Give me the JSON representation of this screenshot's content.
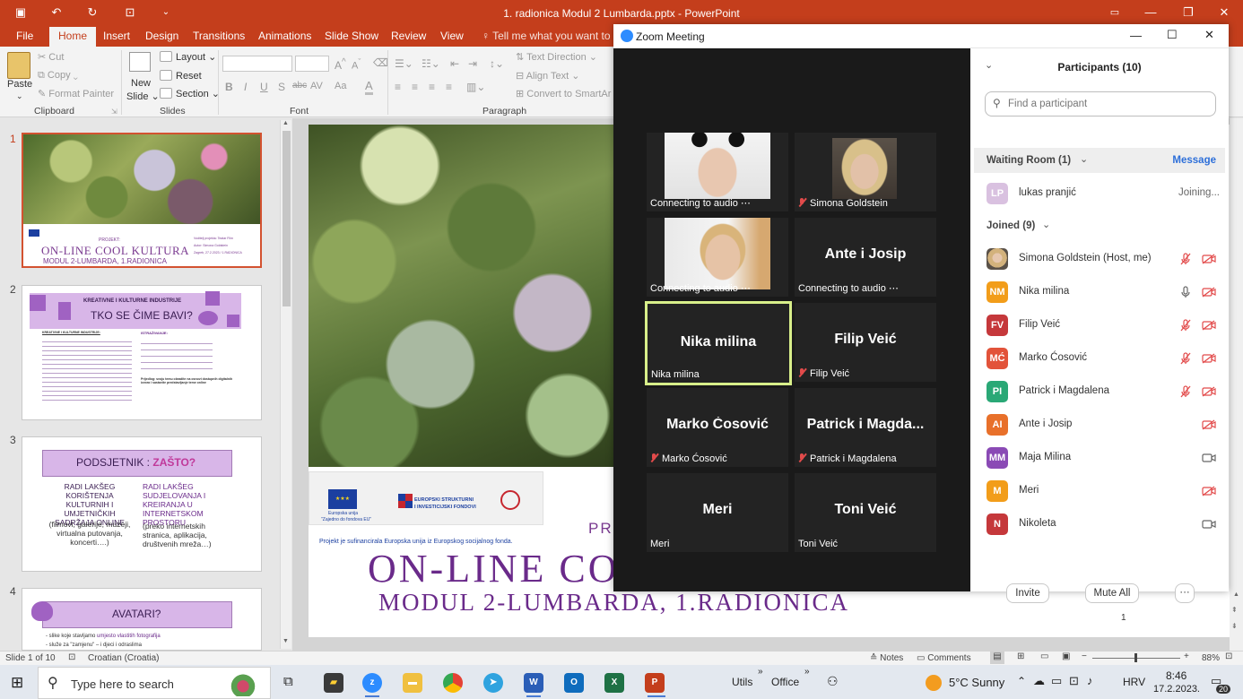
{
  "ppt": {
    "window_title": "1. radionica Modul 2 Lumbarda.pptx - PowerPoint",
    "tabs": [
      "File",
      "Home",
      "Insert",
      "Design",
      "Transitions",
      "Animations",
      "Slide Show",
      "Review",
      "View"
    ],
    "tell_me": "Tell me what you want to d",
    "clipboard": {
      "paste": "Paste",
      "cut": "Cut",
      "copy": "Copy",
      "format_painter": "Format Painter",
      "label": "Clipboard"
    },
    "slides_group": {
      "new_slide": "New",
      "new_slide2": "Slide",
      "layout": "Layout",
      "reset": "Reset",
      "section": "Section",
      "label": "Slides"
    },
    "font_group": {
      "label": "Font",
      "bold": "B",
      "italic": "I",
      "underline": "U",
      "shadow": "S",
      "strike": "abc",
      "spacing": "AV",
      "case": "Aa",
      "color": "A"
    },
    "paragraph_group": {
      "label": "Paragraph",
      "text_direction": "Text Direction",
      "align_text": "Align Text",
      "smartart": "Convert to SmartAr"
    },
    "slide_numbers": [
      "1",
      "2",
      "3",
      "4"
    ],
    "thumb1": {
      "projekt": "PROJEKT:",
      "title": "ON-LINE COOL KULTURA",
      "subtitle": "MODUL 2-LUMBARDA, 1.RADIONICA",
      "info1": "Voditelj projekta: Teatar Film",
      "info2": "Autor: Simona Goldstein",
      "info3": "Zagreb, 27.2.2023 / 1.RADIONICA"
    },
    "thumb2": {
      "title_small": "KREATIVNE I KULTURNE INDUSTRIJE",
      "title": "TKO SE ČIME BAVI?",
      "col1_head": "KREATIVNE I KULTURNE INDUSTRIJE:",
      "col2_head": "ISTRAŽIVANJE:",
      "bottom": "Prijedlog: svoju temu obradite na osnovi dostupnih digitalnih izvora i sastavite predstavljanje teme online"
    },
    "thumb3": {
      "title_a": "PODSJETNIK : ",
      "title_b": "ZAŠTO?",
      "left": "RADI LAKŠEG KORIŠTENJA KULTURNIH I UMJETNIČKIH SADRŽAJA ONLINE",
      "left2": "(filmovi, galerije, muzeji, virtualna putovanja, koncerti….)",
      "right": "RADI LAKŠEG SUDJELOVANJA I KREIRANJA U INTERNETSKOM PROSTORU",
      "right2": "(preko internetskih stranica, aplikacija, društvenih mreža…)"
    },
    "thumb4": {
      "title": "AVATARI?",
      "line1": "- slike koje stavljamo ",
      "line1b": "umjesto vlastitih fotografija",
      "line2": "- služe za \"zamjenu\" – i djeci i odraslima"
    },
    "main_slide": {
      "projekt_fragment": "PR",
      "title_fragment": "ON-LINE CO",
      "subtitle": "MODUL 2-LUMBARDA, 1.RADIONICA",
      "eu_fund_caption": "Projekt je sufinancirala Europska unija iz Europskog socijalnog fonda.",
      "eu_label": "Europska unija",
      "eu_label2": "\"Zajedno do fondova EU\"",
      "esf_logo_1": "EUROPSKI STRUKTURNI",
      "esf_logo_2": "I INVESTICIJSKI FONDOVI",
      "page_num": "1"
    },
    "status": {
      "slide": "Slide 1 of 10",
      "language": "Croatian (Croatia)",
      "notes": "Notes",
      "comments": "Comments",
      "zoom": "88%"
    }
  },
  "zoom": {
    "title": "Zoom Meeting",
    "tiles": [
      {
        "name": "Connecting to audio",
        "big": "",
        "muted": false,
        "video": "girl1",
        "active": false
      },
      {
        "name": "Simona Goldstein",
        "big": "",
        "muted": true,
        "video": "simona",
        "active": false
      },
      {
        "name": "Connecting to audio",
        "big": "",
        "muted": false,
        "video": "girl2",
        "active": false
      },
      {
        "name": "Connecting to audio",
        "big": "Ante i Josip",
        "muted": false,
        "video": "",
        "active": false
      },
      {
        "name": "Nika milina",
        "big": "Nika milina",
        "muted": false,
        "video": "",
        "active": true
      },
      {
        "name": "Filip Veić",
        "big": "Filip Veić",
        "muted": true,
        "video": "",
        "active": false
      },
      {
        "name": "Marko Ćosović",
        "big": "Marko Ćosović",
        "muted": true,
        "video": "",
        "active": false
      },
      {
        "name": "Patrick i Magdalena",
        "big": "Patrick  i  Magda...",
        "muted": true,
        "video": "",
        "active": false
      },
      {
        "name": "Meri",
        "big": "Meri",
        "muted": false,
        "video": "",
        "active": false
      },
      {
        "name": "Toni Veić",
        "big": "Toni Veić",
        "muted": false,
        "video": "",
        "active": false
      }
    ],
    "panel": {
      "title": "Participants (10)",
      "search_placeholder": "Find a participant",
      "waiting_room": "Waiting Room (1)",
      "message": "Message",
      "waiting": {
        "initials": "LP",
        "name": "lukas pranjić",
        "status": "Joining..."
      },
      "joined": "Joined (9)",
      "participants": [
        {
          "initials": "",
          "name": "Simona Goldstein (Host, me)",
          "color": "#c9a36a",
          "mic": "muted",
          "cam": "off"
        },
        {
          "initials": "NM",
          "name": "Nika milina",
          "color": "#f29d1a",
          "mic": "on",
          "cam": "off"
        },
        {
          "initials": "FV",
          "name": "Filip Veić",
          "color": "#c5383b",
          "mic": "muted",
          "cam": "off"
        },
        {
          "initials": "MĆ",
          "name": "Marko Ćosović",
          "color": "#e2533a",
          "mic": "muted",
          "cam": "off"
        },
        {
          "initials": "PI",
          "name": "Patrick i Magdalena",
          "color": "#2aa876",
          "mic": "muted",
          "cam": "off"
        },
        {
          "initials": "AI",
          "name": "Ante i Josip",
          "color": "#e8702a",
          "mic": "none",
          "cam": "off"
        },
        {
          "initials": "MM",
          "name": "Maja Milina",
          "color": "#8a4ab5",
          "mic": "none",
          "cam": "on"
        },
        {
          "initials": "M",
          "name": "Meri",
          "color": "#f29d1a",
          "mic": "none",
          "cam": "off"
        },
        {
          "initials": "N",
          "name": "Nikoleta",
          "color": "#c5383b",
          "mic": "none",
          "cam": "on"
        }
      ],
      "invite": "Invite",
      "mute_all": "Mute All",
      "more": "···"
    }
  },
  "taskbar": {
    "search": "Type here to search",
    "utils": "Utils",
    "office": "Office",
    "weather": "5°C  Sunny",
    "lang": "HRV",
    "time": "8:46",
    "date": "17.2.2023.",
    "notif": "20"
  }
}
